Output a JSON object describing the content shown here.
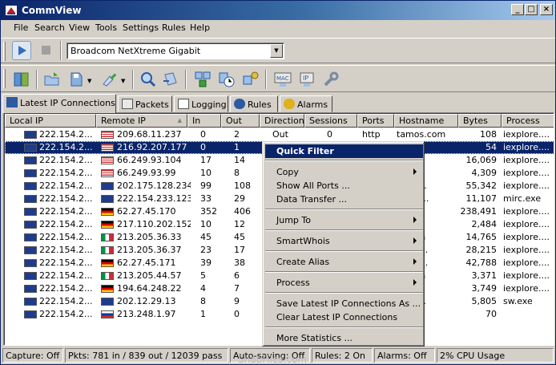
{
  "window": {
    "title": "CommView"
  },
  "menu": [
    "File",
    "Search",
    "View",
    "Tools",
    "Settings",
    "Rules",
    "Help"
  ],
  "toolbar": {
    "adapter": "Broadcom NetXtreme Gigabit"
  },
  "tabs": [
    "Latest IP Connections",
    "Packets",
    "Logging",
    "Rules",
    "Alarms"
  ],
  "columns": [
    "Local IP",
    "Remote IP",
    "In",
    "Out",
    "Direction",
    "Sessions",
    "Ports",
    "Hostname",
    "Bytes",
    "Process"
  ],
  "rows": [
    {
      "local": "222.154.2...",
      "remote": "209.68.11.237",
      "in": "0",
      "out": "2",
      "dir": "Out",
      "sess": "0",
      "ports": "http",
      "host": "tamos.com",
      "bytes": "108",
      "proc": "iexplore....",
      "flag": "us"
    },
    {
      "local": "222.154.2...",
      "remote": "216.92.207.177",
      "in": "0",
      "out": "1",
      "dir": "",
      "sess": "",
      "ports": "",
      "host": "ols...",
      "bytes": "54",
      "proc": "iexplore....",
      "flag": "us",
      "selected": true
    },
    {
      "local": "222.154.2...",
      "remote": "66.249.93.104",
      "in": "17",
      "out": "14",
      "dir": "",
      "sess": "",
      "ports": "",
      "host": "",
      "bytes": "16,069",
      "proc": "iexplore....",
      "flag": "us"
    },
    {
      "local": "222.154.2...",
      "remote": "66.249.93.99",
      "in": "10",
      "out": "8",
      "dir": "",
      "sess": "",
      "ports": "",
      "host": "",
      "bytes": "4,309",
      "proc": "iexplore....",
      "flag": "us"
    },
    {
      "local": "222.154.2...",
      "remote": "202.175.128.234",
      "in": "99",
      "out": "108",
      "dir": "",
      "sess": "",
      "ports": "",
      "host": "ebpo...",
      "bytes": "55,342",
      "proc": "iexplore....",
      "flag": "nz"
    },
    {
      "local": "222.154.2...",
      "remote": "222.154.233.123",
      "in": "33",
      "out": "29",
      "dir": "",
      "sess": "",
      "ports": "",
      "host": "amos...",
      "bytes": "11,107",
      "proc": "mirc.exe",
      "flag": "nz"
    },
    {
      "local": "222.154.2...",
      "remote": "62.27.45.170",
      "in": "352",
      "out": "406",
      "dir": "",
      "sess": "",
      "ports": "",
      "host": "",
      "bytes": "238,491",
      "proc": "iexplore....",
      "flag": "de"
    },
    {
      "local": "222.154.2...",
      "remote": "217.110.202.152",
      "in": "10",
      "out": "12",
      "dir": "",
      "sess": "",
      "ports": "",
      "host": "",
      "bytes": "2,484",
      "proc": "iexplore....",
      "flag": "de"
    },
    {
      "local": "222.154.2...",
      "remote": "213.205.36.33",
      "in": "45",
      "out": "45",
      "dir": "",
      "sess": "",
      "ports": "",
      "host": "lli.com",
      "bytes": "14,765",
      "proc": "iexplore....",
      "flag": "it"
    },
    {
      "local": "222.154.2...",
      "remote": "213.205.36.37",
      "in": "23",
      "out": "17",
      "dir": "",
      "sess": "",
      "ports": "",
      "host": "li.tisc...",
      "bytes": "28,215",
      "proc": "iexplore....",
      "flag": "it"
    },
    {
      "local": "222.154.2...",
      "remote": "62.27.45.171",
      "in": "39",
      "out": "38",
      "dir": "",
      "sess": "",
      "ports": "",
      "host": "li.tisc...",
      "bytes": "42,788",
      "proc": "iexplore....",
      "flag": "de"
    },
    {
      "local": "222.154.2...",
      "remote": "213.205.44.57",
      "in": "5",
      "out": "6",
      "dir": "",
      "sess": "",
      "ports": "",
      "host": "lli.com",
      "bytes": "3,371",
      "proc": "iexplore....",
      "flag": "it"
    },
    {
      "local": "222.154.2...",
      "remote": "194.64.248.22",
      "in": "4",
      "out": "7",
      "dir": "",
      "sess": "",
      "ports": "",
      "host": "",
      "bytes": "3,749",
      "proc": "iexplore....",
      "flag": "de"
    },
    {
      "local": "222.154.2...",
      "remote": "202.12.29.13",
      "in": "8",
      "out": "9",
      "dir": "",
      "sess": "",
      "ports": "",
      "host": "pnic....",
      "bytes": "5,805",
      "proc": "sw.exe",
      "flag": "au"
    },
    {
      "local": "222.154.2...",
      "remote": "213.248.1.97",
      "in": "1",
      "out": "0",
      "dir": "",
      "sess": "",
      "ports": "",
      "host": "0.br...",
      "bytes": "70",
      "proc": "",
      "flag": "ru"
    }
  ],
  "context_menu": {
    "quick_filter": "Quick Filter",
    "copy": "Copy",
    "show_all_ports": "Show All Ports ...",
    "data_transfer": "Data Transfer ...",
    "jump_to": "Jump To",
    "smart_whois": "SmartWhois",
    "create_alias": "Create Alias",
    "process": "Process",
    "save_latest": "Save Latest IP Connections As ...",
    "clear_latest": "Clear Latest IP Connections",
    "more_statistics": "More Statistics ..."
  },
  "status": {
    "capture": "Capture: Off",
    "pkts": "Pkts: 781 in / 839 out / 12039 pass",
    "autosaving": "Auto-saving: Off",
    "rules": "Rules: 2 On",
    "alarms": "Alarms: Off",
    "cpu": "2% CPU Usage"
  },
  "watermark": "SnapFiles.com"
}
